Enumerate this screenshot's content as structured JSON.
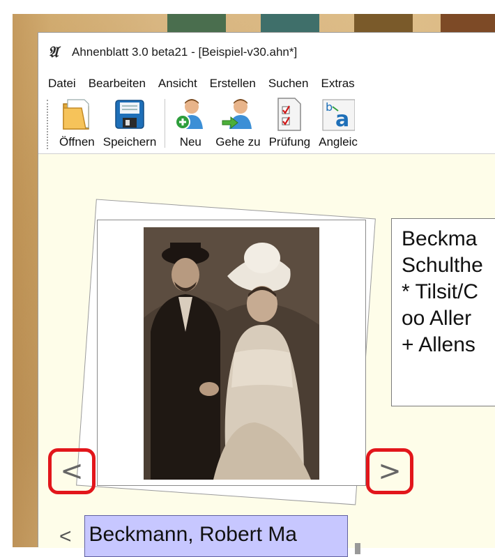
{
  "window": {
    "title": "Ahnenblatt 3.0 beta21 - [Beispiel-v30.ahn*]",
    "app_icon_glyph": "𝔄"
  },
  "menu": {
    "items": [
      "Datei",
      "Bearbeiten",
      "Ansicht",
      "Erstellen",
      "Suchen",
      "Extras"
    ]
  },
  "toolbar": {
    "buttons": [
      {
        "label": "Öffnen",
        "icon": "folder-icon"
      },
      {
        "label": "Speichern",
        "icon": "floppy-disk-icon"
      },
      {
        "label": "Neu",
        "icon": "add-person-icon"
      },
      {
        "label": "Gehe zu",
        "icon": "goto-person-icon"
      },
      {
        "label": "Prüfung",
        "icon": "checklist-icon"
      },
      {
        "label": "Angleic",
        "icon": "replace-text-icon"
      }
    ]
  },
  "person_info": {
    "lines": [
      "Beckma",
      "Schulthe",
      "* Tilsit/C",
      "oo Aller",
      "+ Allens"
    ]
  },
  "photo_nav": {
    "prev": "<",
    "next": ">"
  },
  "name_selector": {
    "prev": "<",
    "value": "Beckmann, Robert Ma"
  },
  "colors": {
    "highlight_border": "#e2161b",
    "name_field_bg": "#c7c7ff",
    "content_bg": "#fefde9"
  }
}
